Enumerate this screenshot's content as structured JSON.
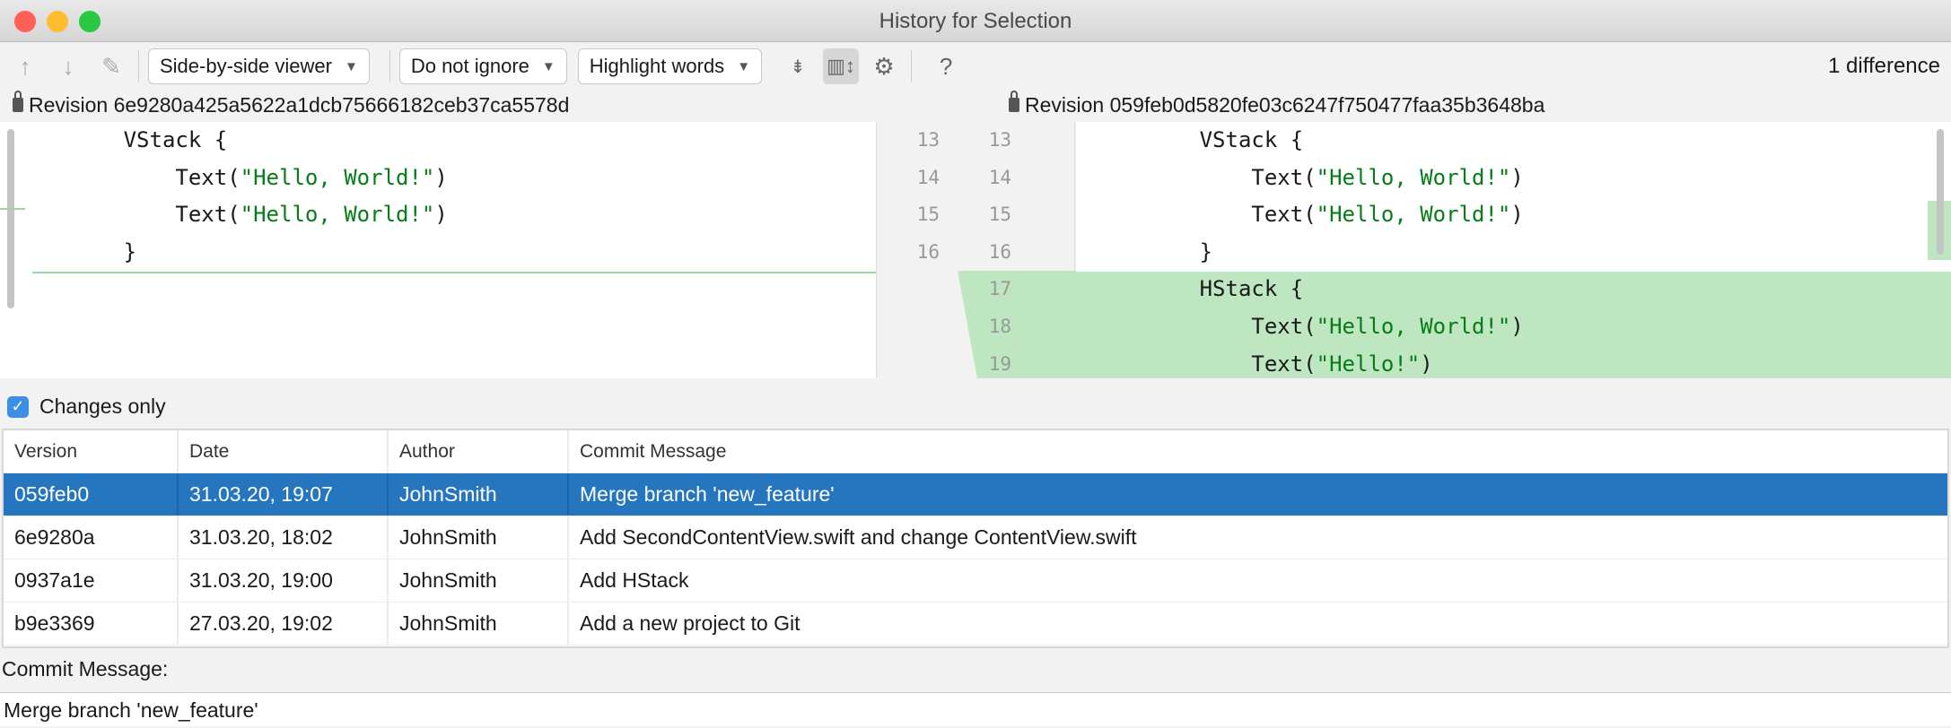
{
  "window": {
    "title": "History for Selection"
  },
  "toolbar": {
    "viewer": "Side-by-side viewer",
    "ignore": "Do not ignore",
    "highlight": "Highlight words",
    "help": "?",
    "difference_count": "1 difference"
  },
  "left": {
    "revision": "Revision 6e9280a425a5622a1dcb75666182ceb37ca5578d",
    "lines": [
      {
        "num": "13",
        "indent": "        ",
        "code": "VStack {",
        "str": "",
        "end": ""
      },
      {
        "num": "14",
        "indent": "            ",
        "code": "Text(",
        "str": "\"Hello, World!\"",
        "end": ")"
      },
      {
        "num": "15",
        "indent": "            ",
        "code": "Text(",
        "str": "\"Hello, World!\"",
        "end": ")"
      },
      {
        "num": "16",
        "indent": "        ",
        "code": "}",
        "str": "",
        "end": ""
      }
    ]
  },
  "right": {
    "revision": "Revision 059feb0d5820fe03c6247f750477faa35b3648ba",
    "lines": [
      {
        "num": "13",
        "indent": "        ",
        "code": "VStack {",
        "str": "",
        "end": ""
      },
      {
        "num": "14",
        "indent": "            ",
        "code": "Text(",
        "str": "\"Hello, World!\"",
        "end": ")"
      },
      {
        "num": "15",
        "indent": "            ",
        "code": "Text(",
        "str": "\"Hello, World!\"",
        "end": ")"
      },
      {
        "num": "16",
        "indent": "        ",
        "code": "}",
        "str": "",
        "end": ""
      },
      {
        "num": "17",
        "indent": "        ",
        "code": "HStack {",
        "str": "",
        "end": ""
      },
      {
        "num": "18",
        "indent": "            ",
        "code": "Text(",
        "str": "\"Hello, World!\"",
        "end": ")"
      },
      {
        "num": "19",
        "indent": "            ",
        "code": "Text(",
        "str": "\"Hello!\"",
        "end": ")"
      }
    ]
  },
  "colors": {
    "added": "#bee6c0",
    "selection": "#2675bf",
    "string": "#067d17"
  },
  "changes_only": {
    "label": "Changes only",
    "checked": true
  },
  "table": {
    "headers": [
      "Version",
      "Date",
      "Author",
      "Commit Message"
    ],
    "rows": [
      [
        "059feb0",
        "31.03.20, 19:07",
        "JohnSmith",
        "Merge branch 'new_feature'"
      ],
      [
        "6e9280a",
        "31.03.20, 18:02",
        "JohnSmith",
        "Add SecondContentView.swift and change ContentView.swift"
      ],
      [
        "0937a1e",
        "31.03.20, 19:00",
        "JohnSmith",
        "Add HStack"
      ],
      [
        "b9e3369",
        "27.03.20, 19:02",
        "JohnSmith",
        "Add a new project to Git"
      ]
    ],
    "selected_index": 0
  },
  "commit": {
    "label": "Commit Message:",
    "value": "Merge branch 'new_feature'"
  }
}
